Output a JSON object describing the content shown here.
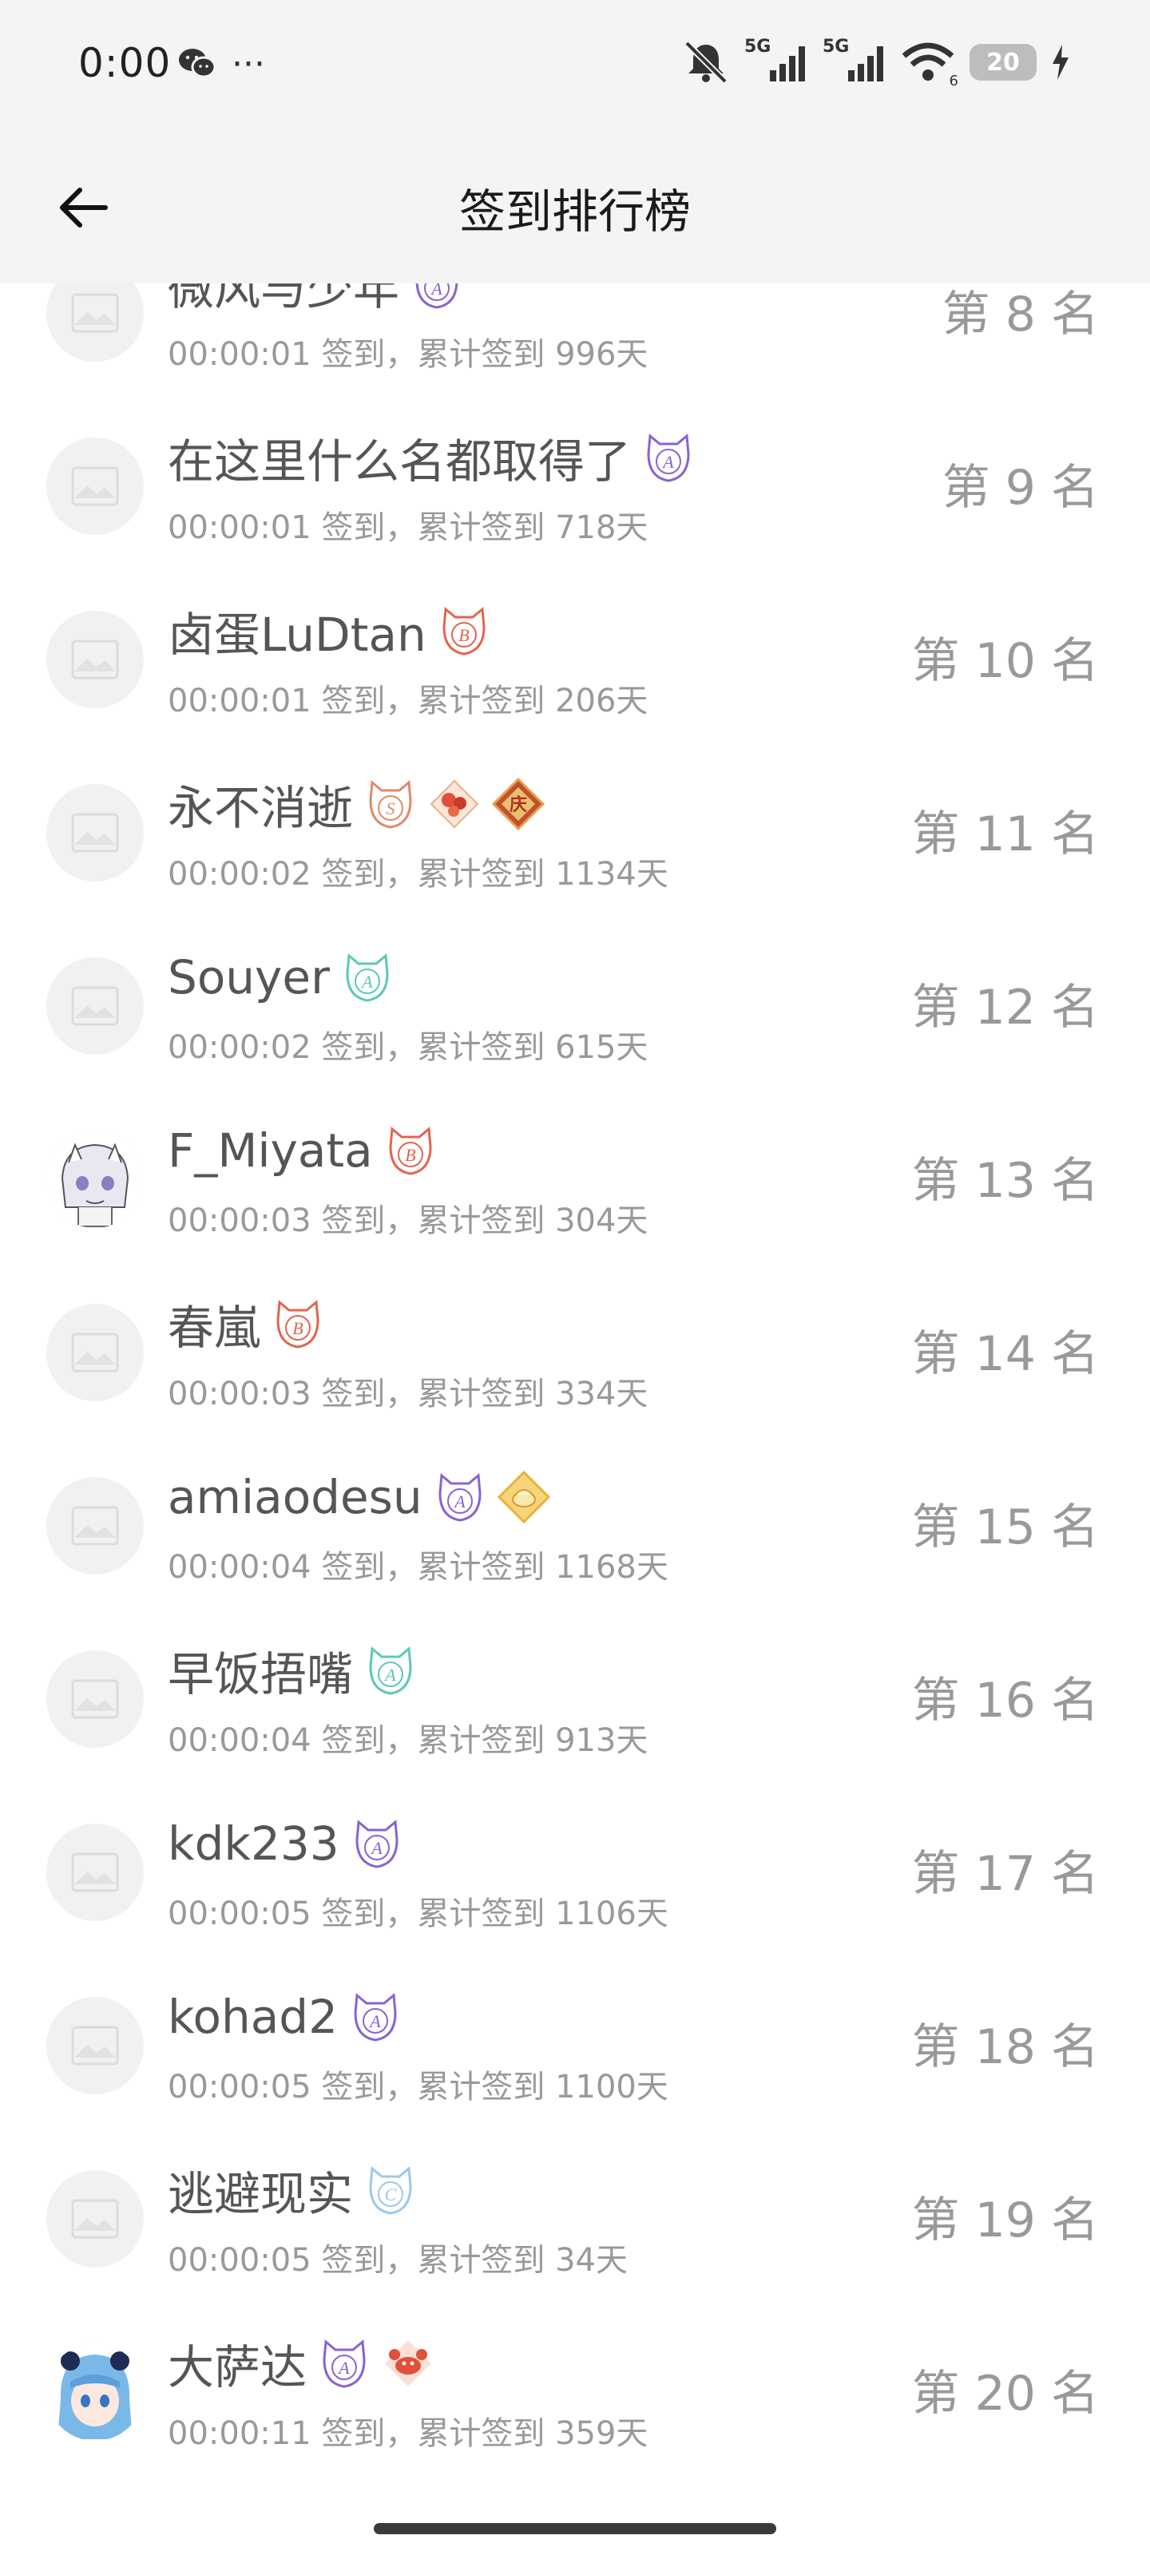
{
  "status_bar": {
    "time": "0:00",
    "more": "···",
    "signal_1": "5G",
    "signal_2": "5G",
    "wifi_sub": "6",
    "battery": "20"
  },
  "header": {
    "title": "签到排行榜"
  },
  "colors": {
    "badge_purple": "#8a63d2",
    "badge_red": "#e0664f",
    "badge_teal": "#5cc8b8",
    "badge_blue": "#9cc8ee",
    "muted_text": "#999999",
    "name_text": "#555555"
  },
  "rows": [
    {
      "name": "微风与少年",
      "sub": "00:00:01 签到，累计签到 996天",
      "rank": "第 8 名",
      "avatar": "placeholder-image",
      "badges": [
        {
          "icon": "cat-badge-A",
          "color": "#8a63d2",
          "letter": "A"
        }
      ]
    },
    {
      "name": "在这里什么名都取得了",
      "sub": "00:00:01 签到，累计签到 718天",
      "rank": "第 9 名",
      "avatar": "placeholder-image",
      "badges": [
        {
          "icon": "cat-badge-A",
          "color": "#8a63d2",
          "letter": "A"
        }
      ]
    },
    {
      "name": "卤蛋LuDtan",
      "sub": "00:00:01 签到，累计签到 206天",
      "rank": "第 10 名",
      "avatar": "placeholder-image",
      "badges": [
        {
          "icon": "cat-badge-B",
          "color": "#e0664f",
          "letter": "B"
        }
      ]
    },
    {
      "name": "永不消逝",
      "sub": "00:00:02 签到，累计签到 1134天",
      "rank": "第 11 名",
      "avatar": "placeholder-image",
      "badges": [
        {
          "icon": "cat-badge-S",
          "color": "#e08a6a",
          "letter": "S"
        },
        {
          "icon": "flower-medal",
          "color": "#e06a4f",
          "letter": ""
        },
        {
          "icon": "diamond-medal",
          "color": "#c0502f",
          "letter": "庆"
        }
      ]
    },
    {
      "name": "Souyer",
      "sub": "00:00:02 签到，累计签到 615天",
      "rank": "第 12 名",
      "avatar": "placeholder-image",
      "badges": [
        {
          "icon": "cat-badge-A",
          "color": "#5cc8b8",
          "letter": "A"
        }
      ]
    },
    {
      "name": "F_Miyata",
      "sub": "00:00:03 签到，累计签到 304天",
      "rank": "第 13 名",
      "avatar": "anime-avatar",
      "badges": [
        {
          "icon": "cat-badge-B",
          "color": "#e0664f",
          "letter": "B"
        }
      ]
    },
    {
      "name": "春嵐",
      "sub": "00:00:03 签到，累计签到 334天",
      "rank": "第 14 名",
      "avatar": "placeholder-image",
      "badges": [
        {
          "icon": "cat-badge-B",
          "color": "#e0664f",
          "letter": "B"
        }
      ]
    },
    {
      "name": "amiaodesu",
      "sub": "00:00:04 签到，累计签到 1168天",
      "rank": "第 15 名",
      "avatar": "placeholder-image",
      "badges": [
        {
          "icon": "cat-badge-A",
          "color": "#8a63d2",
          "letter": "A"
        },
        {
          "icon": "gold-medal",
          "color": "#e8b23a",
          "letter": ""
        }
      ]
    },
    {
      "name": "早饭捂嘴",
      "sub": "00:00:04 签到，累计签到 913天",
      "rank": "第 16 名",
      "avatar": "placeholder-image",
      "badges": [
        {
          "icon": "cat-badge-A",
          "color": "#5cc8b8",
          "letter": "A"
        }
      ]
    },
    {
      "name": "kdk233",
      "sub": "00:00:05 签到，累计签到 1106天",
      "rank": "第 17 名",
      "avatar": "placeholder-image",
      "badges": [
        {
          "icon": "cat-badge-A",
          "color": "#8a63d2",
          "letter": "A"
        }
      ]
    },
    {
      "name": "kohad2",
      "sub": "00:00:05 签到，累计签到 1100天",
      "rank": "第 18 名",
      "avatar": "placeholder-image",
      "badges": [
        {
          "icon": "cat-badge-A",
          "color": "#8a63d2",
          "letter": "A"
        }
      ]
    },
    {
      "name": "逃避现实",
      "sub": "00:00:05 签到，累计签到 34天",
      "rank": "第 19 名",
      "avatar": "placeholder-image",
      "badges": [
        {
          "icon": "cat-badge-C",
          "color": "#9cc8ee",
          "letter": "C"
        }
      ]
    },
    {
      "name": "大萨达",
      "sub": "00:00:11 签到，累计签到 359天",
      "rank": "第 20 名",
      "avatar": "blue-hair-avatar",
      "badges": [
        {
          "icon": "cat-badge-A",
          "color": "#8a63d2",
          "letter": "A"
        },
        {
          "icon": "crab-medal",
          "color": "#e0664f",
          "letter": ""
        }
      ]
    }
  ]
}
